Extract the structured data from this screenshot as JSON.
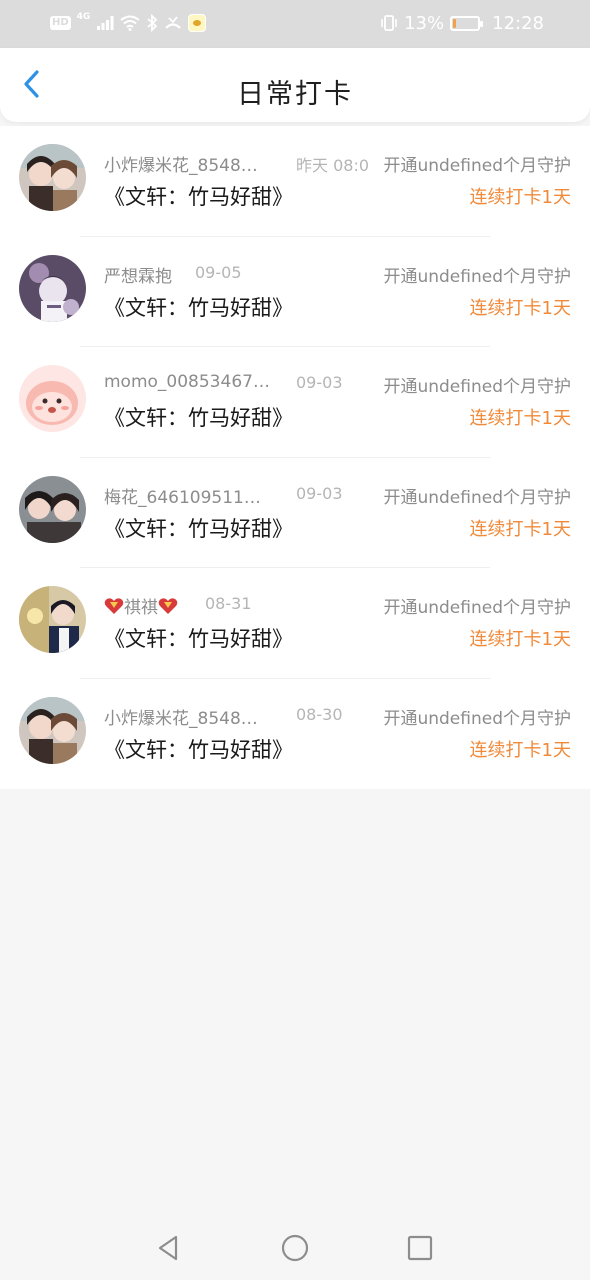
{
  "status_bar": {
    "hd_label": "HD",
    "network_label": "4G",
    "battery_percent_text": "13%",
    "battery_level": 0.13,
    "time": "12:28"
  },
  "header": {
    "title": "日常打卡",
    "back_icon": "chevron-left-icon",
    "accent_color": "#2c92e8"
  },
  "checkins": [
    {
      "username": "小炸爆米花_8548…",
      "date": "昨天 08:0",
      "book": "《文轩：竹马好甜》",
      "guard": "开通undefined个月守护",
      "streak": "连续打卡1天"
    },
    {
      "username": "严想霖抱",
      "date": "09-05",
      "book": "《文轩：竹马好甜》",
      "guard": "开通undefined个月守护",
      "streak": "连续打卡1天"
    },
    {
      "username": "momo_00853467…",
      "date": "09-03",
      "book": "《文轩：竹马好甜》",
      "guard": "开通undefined个月守护",
      "streak": "连续打卡1天"
    },
    {
      "username": "梅花_646109511…",
      "date": "09-03",
      "book": "《文轩：竹马好甜》",
      "guard": "开通undefined个月守护",
      "streak": "连续打卡1天"
    },
    {
      "username": "祺祺",
      "date": "08-31",
      "book": "《文轩：竹马好甜》",
      "guard": "开通undefined个月守护",
      "streak": "连续打卡1天"
    },
    {
      "username": "小炸爆米花_8548…",
      "date": "08-30",
      "book": "《文轩：竹马好甜》",
      "guard": "开通undefined个月守护",
      "streak": "连续打卡1天"
    }
  ],
  "colors": {
    "streak": "#f08a3a",
    "muted_text": "#8c8c8c",
    "primary_text": "#1a1a1a"
  },
  "nav_bar": {
    "back_icon": "triangle-back-icon",
    "home_icon": "circle-home-icon",
    "recent_icon": "square-recent-icon"
  }
}
